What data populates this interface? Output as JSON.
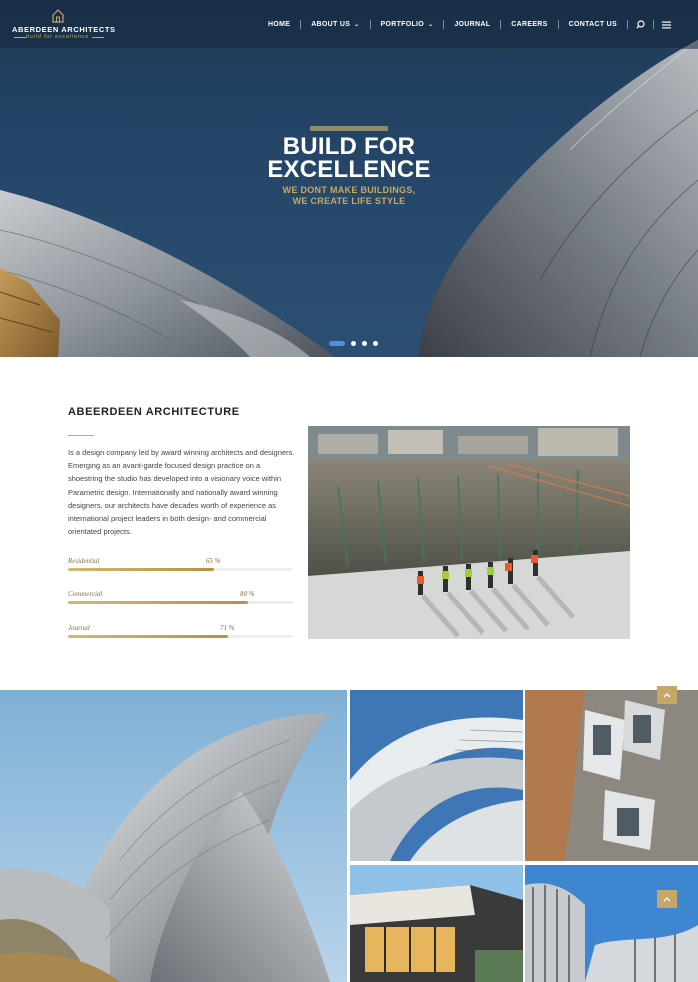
{
  "header": {
    "logo_name": "ABERDEEN ARCHITECTS",
    "logo_tagline": "build for excellence",
    "nav": [
      {
        "label": "HOME"
      },
      {
        "label": "ABOUT US",
        "dropdown": true
      },
      {
        "label": "PORTFOLIO",
        "dropdown": true
      },
      {
        "label": "JOURNAL"
      },
      {
        "label": "CAREERS"
      },
      {
        "label": "CONTACT US"
      }
    ],
    "icons": [
      "search-icon",
      "menu-icon"
    ]
  },
  "hero": {
    "title_line1": "BUILD FOR",
    "title_line2": "EXCELLENCE",
    "subtitle_line1": "WE DONT MAKE BUILDINGS,",
    "subtitle_line2": "WE CREATE LIFE STYLE",
    "slides": 4,
    "active_slide": 1
  },
  "about": {
    "title": "ABEERDEEN ARCHITECTURE",
    "text": "Is a design company led by award winning architects and designers. Emerging as an avant-garde focused design practice on a shoestring the studio has developed into a visionary voice within Parametric design. Internationally and nationally award winning designers, our architects have decades worth of experience as international project leaders in both design- and commercial orientated projects.",
    "skills": [
      {
        "label": "Residential",
        "pct_text": "65 %",
        "value": 0.65
      },
      {
        "label": "Commercial",
        "pct_text": "80 %",
        "value": 0.8
      },
      {
        "label": "Journal",
        "pct_text": "71 %",
        "value": 0.71
      }
    ]
  },
  "colors": {
    "accent_gold": "#c6a767",
    "hero_blue": "#254668",
    "slider_active": "#4a90e2"
  },
  "icons": {
    "scroll_top": "chevron-up-icon"
  }
}
